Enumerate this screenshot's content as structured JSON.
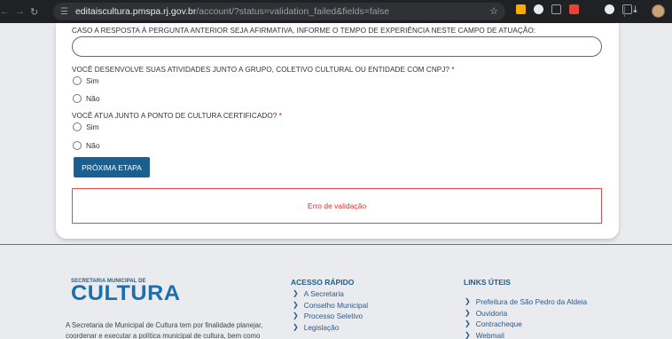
{
  "browser": {
    "url_host": "editaiscultura.pmspa.rj.gov.br",
    "url_path": "/account/?status=validation_failed&fields=false"
  },
  "form": {
    "q_experience": "CASO A RESPOSTA À PERGUNTA ANTERIOR SEJA AFIRMATIVA, INFORME O TEMPO DE EXPERIÊNCIA NESTE CAMPO DE ATUAÇÃO:",
    "q_group": "VOCÊ DESENVOLVE SUAS ATIVIDADES JUNTO A GRUPO, COLETIVO CULTURAL OU ENTIDADE COM CNPJ?",
    "q_point": "VOCÊ ATUA JUNTO A PONTO DE CULTURA CERTIFICADO?",
    "required_mark": "*",
    "opt_yes": "Sim",
    "opt_no": "Não",
    "next_label": "PRÓXIMA ETAPA",
    "error_message": "Erro de validação"
  },
  "footer": {
    "logo_sub": "SECRETARIA MUNICIPAL DE",
    "logo_main": "CULTURA",
    "about": "A Secretaria de Municipal de Cultura tem por finalidade planejar, coordenar e executar a política municipal de cultura, bem como",
    "quick_title": "ACESSO RÁPIDO",
    "quick_links": [
      "A Secretaria",
      "Conselho Municipal",
      "Processo Seletivo",
      "Legislação"
    ],
    "useful_title": "LINKS ÚTEIS",
    "useful_links": [
      "Prefeitura de São Pedro da Aldeia",
      "Ouvidoria",
      "Contracheque",
      "Webmail"
    ]
  }
}
